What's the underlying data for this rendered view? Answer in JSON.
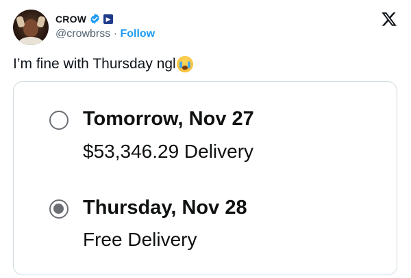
{
  "tweet": {
    "author_name": "CROW",
    "handle": "@crowbrss",
    "separator": "·",
    "follow_label": "Follow",
    "text": "I’m fine with Thursday ngl"
  },
  "delivery_options": [
    {
      "title": "Tomorrow, Nov 27",
      "subtitle": "$53,346.29 Delivery",
      "selected": false
    },
    {
      "title": "Thursday, Nov 28",
      "subtitle": "Free Delivery",
      "selected": true
    }
  ],
  "colors": {
    "follow": "#1d9bf0",
    "verified": "#1d9bf0",
    "muted": "#536471",
    "radio": "#6b6f73"
  },
  "icons": [
    "verified-badge-icon",
    "affiliate-badge-icon",
    "x-logo-icon",
    "crying-face-emoji-icon"
  ]
}
